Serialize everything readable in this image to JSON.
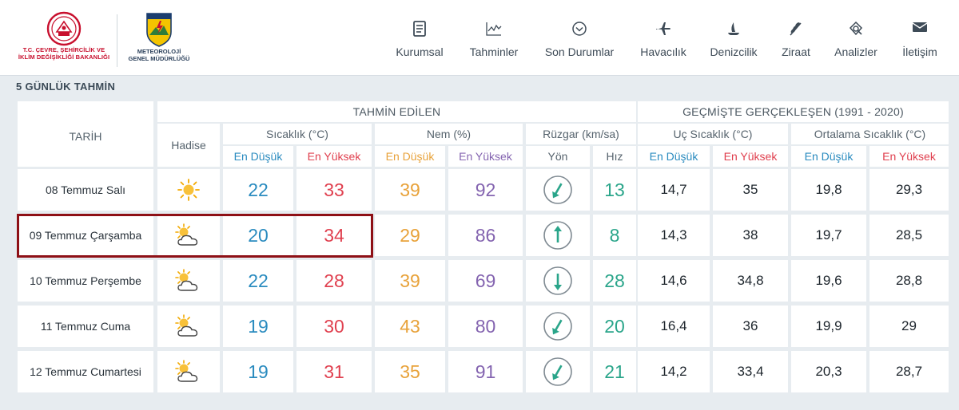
{
  "header": {
    "ministry_logo_lines": [
      "T.C. ÇEVRE, ŞEHİRCİLİK VE",
      "İKLİM DEĞİŞİKLİĞİ BAKANLIĞI"
    ],
    "mgm_logo_lines": [
      "METEOROLOJİ",
      "GENEL MÜDÜRLÜĞÜ"
    ],
    "nav": [
      {
        "label": "Kurumsal",
        "icon": "document-icon"
      },
      {
        "label": "Tahminler",
        "icon": "chart-icon"
      },
      {
        "label": "Son Durumlar",
        "icon": "chevron-circle-icon"
      },
      {
        "label": "Havacılık",
        "icon": "airplane-icon"
      },
      {
        "label": "Denizcilik",
        "icon": "boat-icon"
      },
      {
        "label": "Ziraat",
        "icon": "wheat-icon"
      },
      {
        "label": "Analizler",
        "icon": "analysis-icon"
      },
      {
        "label": "İletişim",
        "icon": "envelope-icon"
      }
    ]
  },
  "section_title": "5 GÜNLÜK TAHMİN",
  "table": {
    "group_forecast": "TAHMİN EDİLEN",
    "group_history": "GEÇMİŞTE GERÇEKLEŞEN (1991 - 2020)",
    "col_date": "TARİH",
    "col_event": "Hadise",
    "col_temp": "Sıcaklık (°C)",
    "col_humidity": "Nem (%)",
    "col_wind": "Rüzgar (km/sa)",
    "col_extreme": "Uç Sıcaklık (°C)",
    "col_average": "Ortalama Sıcaklık (°C)",
    "sub_low": "En Düşük",
    "sub_high": "En Yüksek",
    "sub_direction": "Yön",
    "sub_speed": "Hız",
    "highlight_color": "#8e1016",
    "rows": [
      {
        "date": "08 Temmuz Salı",
        "icon": "sun-icon",
        "temp_low": "22",
        "temp_high": "33",
        "hum_low": "39",
        "hum_high": "92",
        "wind_dir": "southwest",
        "wind_speed": "13",
        "ext_low": "14,7",
        "ext_high": "35",
        "avg_low": "19,8",
        "avg_high": "29,3"
      },
      {
        "date": "09 Temmuz Çarşamba",
        "icon": "partly-cloudy-icon",
        "temp_low": "20",
        "temp_high": "34",
        "hum_low": "29",
        "hum_high": "86",
        "wind_dir": "north",
        "wind_speed": "8",
        "ext_low": "14,3",
        "ext_high": "38",
        "avg_low": "19,7",
        "avg_high": "28,5"
      },
      {
        "date": "10 Temmuz Perşembe",
        "icon": "partly-cloudy-icon",
        "temp_low": "22",
        "temp_high": "28",
        "hum_low": "39",
        "hum_high": "69",
        "wind_dir": "south",
        "wind_speed": "28",
        "ext_low": "14,6",
        "ext_high": "34,8",
        "avg_low": "19,6",
        "avg_high": "28,8"
      },
      {
        "date": "11 Temmuz Cuma",
        "icon": "partly-cloudy-icon",
        "temp_low": "19",
        "temp_high": "30",
        "hum_low": "43",
        "hum_high": "80",
        "wind_dir": "southwest",
        "wind_speed": "20",
        "ext_low": "16,4",
        "ext_high": "36",
        "avg_low": "19,9",
        "avg_high": "29"
      },
      {
        "date": "12 Temmuz Cumartesi",
        "icon": "partly-cloudy-icon",
        "temp_low": "19",
        "temp_high": "31",
        "hum_low": "35",
        "hum_high": "91",
        "wind_dir": "southwest",
        "wind_speed": "21",
        "ext_low": "14,2",
        "ext_high": "33,4",
        "avg_low": "20,3",
        "avg_high": "28,7"
      }
    ]
  }
}
